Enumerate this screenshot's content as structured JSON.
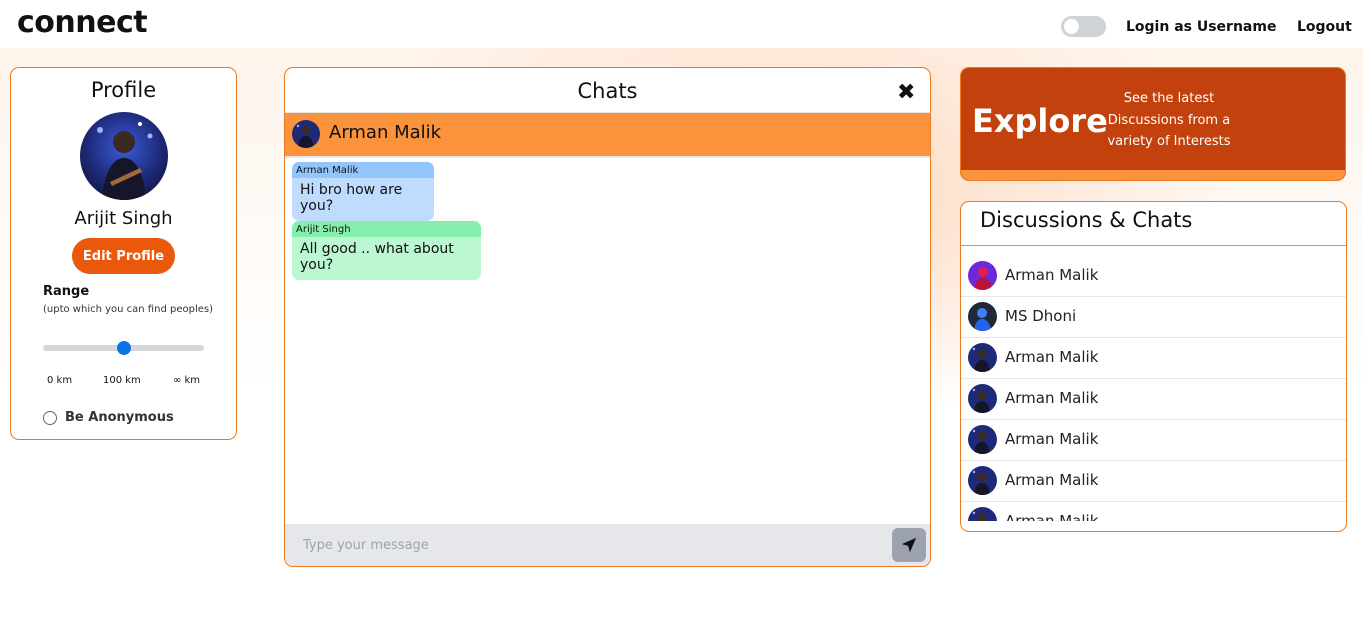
{
  "header": {
    "brand": "connect",
    "login_label": "Login as Username",
    "logout_label": "Logout",
    "theme_toggle_on": false
  },
  "profile": {
    "title": "Profile",
    "name": "Arijit Singh",
    "edit_label": "Edit Profile",
    "range_label": "Range",
    "range_hint": "(upto which you can find peoples)",
    "range_level": 0.5,
    "ticks": [
      "0 km",
      "100 km",
      "∞ km"
    ],
    "anonymous_label": "Be Anonymous"
  },
  "chat": {
    "title": "Chats",
    "contact_name": "Arman Malik",
    "messages": [
      {
        "from": "Arman Malik",
        "text": "Hi bro how are you?"
      },
      {
        "from": "Arijit Singh",
        "text": "All good .. what about you?"
      }
    ],
    "input_placeholder": "Type your message"
  },
  "explore": {
    "title": "Explore",
    "description": "See the latest Discussions from a variety of Interests"
  },
  "discussions": {
    "title": "Discussions & Chats",
    "items": [
      {
        "name": "Arman Malik",
        "avatar": "avatar-red"
      },
      {
        "name": "MS Dhoni",
        "avatar": "avatar-blue"
      },
      {
        "name": "Arman Malik",
        "avatar": "avatar-navy"
      },
      {
        "name": "Arman Malik",
        "avatar": "avatar-navy"
      },
      {
        "name": "Arman Malik",
        "avatar": "avatar-navy"
      },
      {
        "name": "Arman Malik",
        "avatar": "avatar-navy"
      },
      {
        "name": "Arman Malik",
        "avatar": "avatar-navy"
      }
    ]
  },
  "colors": {
    "accent": "#ea580c",
    "chat_header": "#fb923c",
    "explore_bg": "#c2410c",
    "slider_thumb": "#0b72e7"
  }
}
